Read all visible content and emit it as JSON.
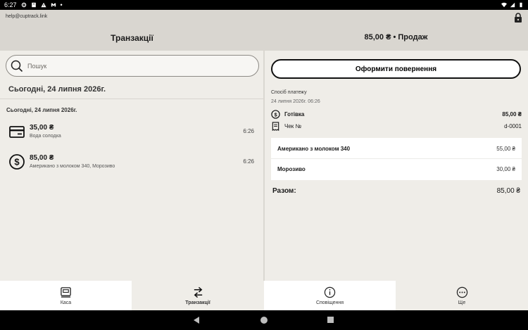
{
  "status_bar": {
    "time": "6:27"
  },
  "header": {
    "email": "help@cuptrack.link",
    "left_title": "Транзакції",
    "right_title": "85,00 ₴  •  Продаж"
  },
  "search": {
    "placeholder": "Пошук"
  },
  "transactions": {
    "date_header": "Сьогодні, 24 липня 2026г.",
    "group_label": "Сьогодні, 24 липня 2026г.",
    "items": [
      {
        "amount": "35,00 ₴",
        "description": "Вода солодка",
        "time": "6:26",
        "icon": "card-icon"
      },
      {
        "amount": "85,00 ₴",
        "description": "Американо з молоком 340, Морозиво",
        "time": "6:26",
        "icon": "cash-icon"
      }
    ]
  },
  "detail": {
    "refund_label": "Оформити повернення",
    "payment_method_label": "Спосіб платежу",
    "payment_datetime": "24 липня 2026г. 06:26",
    "payment": {
      "label": "Готівка",
      "value": "85,00 ₴"
    },
    "receipt": {
      "label": "Чек №",
      "value": "d-0001"
    },
    "items": [
      {
        "name": "Американо з молоком 340",
        "price": "55,00 ₴"
      },
      {
        "name": "Морозиво",
        "price": "30,00 ₴"
      }
    ],
    "total_label": "Разом:",
    "total_value": "85,00 ₴"
  },
  "bottom_nav": {
    "items": [
      {
        "label": "Каса",
        "icon": "register-icon"
      },
      {
        "label": "Транзакції",
        "icon": "swap-arrows-icon",
        "active": true
      },
      {
        "label": "Сповіщення",
        "icon": "info-icon"
      },
      {
        "label": "Ще",
        "icon": "more-icon"
      }
    ]
  }
}
